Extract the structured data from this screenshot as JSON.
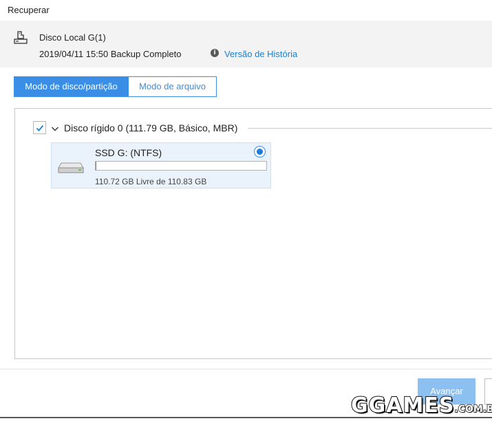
{
  "window": {
    "title": "Recuperar"
  },
  "backup": {
    "disk_name": "Disco Local G(1)",
    "info": "2019/04/11 15:50 Backup Completo",
    "history_link": "Versão de História",
    "icon": "disk-backup-icon"
  },
  "tabs": [
    {
      "label": "Modo de disco/partição",
      "active": true
    },
    {
      "label": "Modo de arquivo",
      "active": false
    }
  ],
  "disk": {
    "label": "Disco rígido 0 (111.79 GB, Básico, MBR)",
    "checked": true,
    "expanded": true
  },
  "partition": {
    "name": "SSD G: (NTFS)",
    "free_text": "110.72 GB Livre de 110.83 GB",
    "used_fraction": 0.001,
    "selected": true,
    "icon": "hard-drive-icon"
  },
  "footer": {
    "next_label": "Avançar"
  },
  "watermark": {
    "main": "GGAMES",
    "tld": ".COM.BR"
  },
  "colors": {
    "accent": "#3a8ee6",
    "link": "#1a7fd4",
    "button_disabled": "#8cc0f0",
    "header_bg": "#f3f3f3",
    "card_bg": "#eaf3fc"
  }
}
